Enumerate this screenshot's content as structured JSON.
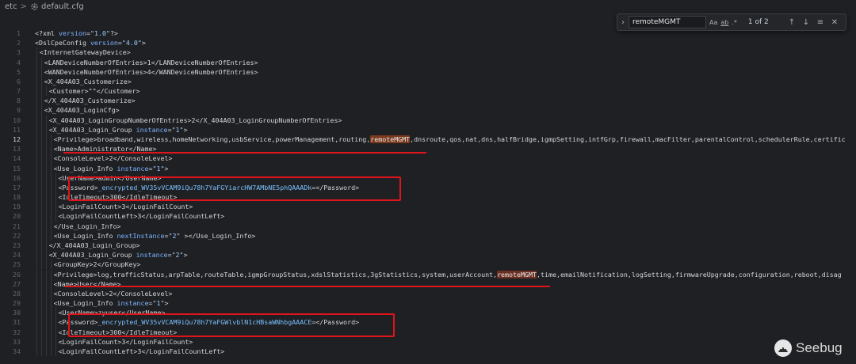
{
  "breadcrumb": {
    "folder": "etc",
    "separator": ">",
    "file": "default.cfg"
  },
  "find_widget": {
    "query": "remoteMGMT",
    "match_case_label": "Aa",
    "whole_word_label": "ab",
    "regex_label": ".*",
    "result": "1 of 2"
  },
  "watermark": {
    "text": "Seebug"
  },
  "current_line": 12,
  "lines": [
    {
      "n": 1,
      "indent": 0,
      "parts": [
        [
          "t",
          "<?xml "
        ],
        [
          "a",
          "version"
        ],
        [
          "t",
          "="
        ],
        [
          "v",
          "\"1.0\""
        ],
        [
          "t",
          "?>"
        ]
      ]
    },
    {
      "n": 2,
      "indent": 0,
      "parts": [
        [
          "t",
          "<DslCpeConfig "
        ],
        [
          "a",
          "version"
        ],
        [
          "t",
          "="
        ],
        [
          "v",
          "\"4.0\""
        ],
        [
          "t",
          ">"
        ]
      ]
    },
    {
      "n": 3,
      "indent": 1,
      "parts": [
        [
          "t",
          "<InternetGatewayDevice>"
        ]
      ]
    },
    {
      "n": 4,
      "indent": 2,
      "parts": [
        [
          "t",
          "<LANDeviceNumberOfEntries>1</LANDeviceNumberOfEntries>"
        ]
      ]
    },
    {
      "n": 5,
      "indent": 2,
      "parts": [
        [
          "t",
          "<WANDeviceNumberOfEntries>4</WANDeviceNumberOfEntries>"
        ]
      ]
    },
    {
      "n": 6,
      "indent": 2,
      "parts": [
        [
          "t",
          "<X_404A03_Customerize>"
        ]
      ]
    },
    {
      "n": 7,
      "indent": 3,
      "parts": [
        [
          "t",
          "<Customer>\"\"</Customer>"
        ]
      ]
    },
    {
      "n": 8,
      "indent": 2,
      "parts": [
        [
          "t",
          "</X_404A03_Customerize>"
        ]
      ]
    },
    {
      "n": 9,
      "indent": 2,
      "parts": [
        [
          "t",
          "<X_404A03_LoginCfg>"
        ]
      ]
    },
    {
      "n": 10,
      "indent": 3,
      "parts": [
        [
          "t",
          "<X_404A03_LoginGroupNumberOfEntries>2</X_404A03_LoginGroupNumberOfEntries>"
        ]
      ]
    },
    {
      "n": 11,
      "indent": 3,
      "parts": [
        [
          "t",
          "<X_404A03_Login_Group "
        ],
        [
          "a",
          "instance"
        ],
        [
          "t",
          "="
        ],
        [
          "v",
          "\"1\""
        ],
        [
          "t",
          ">"
        ]
      ]
    },
    {
      "n": 12,
      "indent": 4,
      "parts": [
        [
          "t",
          "<Privilege>broadband,wireless,homeNetworking,usbService,powerManagement,routing,"
        ],
        [
          "h",
          "remoteMGMT"
        ],
        [
          "t",
          ",dnsroute,qos,nat,dns,halfBridge,igmpSetting,intfGrp,firewall,macFilter,parentalControl,schedulerRule,certific"
        ]
      ]
    },
    {
      "n": 13,
      "indent": 4,
      "parts": [
        [
          "t",
          "<Name>Administrator</Name>"
        ]
      ]
    },
    {
      "n": 14,
      "indent": 4,
      "parts": [
        [
          "t",
          "<ConsoleLevel>2</ConsoleLevel>"
        ]
      ]
    },
    {
      "n": 15,
      "indent": 4,
      "parts": [
        [
          "t",
          "<Use_Login_Info "
        ],
        [
          "a",
          "instance"
        ],
        [
          "t",
          "="
        ],
        [
          "v",
          "\"1\""
        ],
        [
          "t",
          ">"
        ]
      ]
    },
    {
      "n": 16,
      "indent": 5,
      "parts": [
        [
          "t",
          "<UserName>admin</UserName>"
        ]
      ]
    },
    {
      "n": 17,
      "indent": 5,
      "parts": [
        [
          "t",
          "<Password>"
        ],
        [
          "e",
          "_encrypted_WV35vVCAM9iQu78h7YaFGYiarcHW7AMbNE5phQAAADk"
        ],
        [
          "t",
          "=</Password>"
        ]
      ]
    },
    {
      "n": 18,
      "indent": 5,
      "parts": [
        [
          "t",
          "<IdleTimeout>300</IdleTimeout>"
        ]
      ]
    },
    {
      "n": 19,
      "indent": 5,
      "parts": [
        [
          "t",
          "<LoginFailCount>3</LoginFailCount>"
        ]
      ]
    },
    {
      "n": 20,
      "indent": 5,
      "parts": [
        [
          "t",
          "<LoginFailCountLeft>3</LoginFailCountLeft>"
        ]
      ]
    },
    {
      "n": 21,
      "indent": 4,
      "parts": [
        [
          "t",
          "</Use_Login_Info>"
        ]
      ]
    },
    {
      "n": 22,
      "indent": 4,
      "parts": [
        [
          "t",
          "<Use_Login_Info "
        ],
        [
          "a",
          "nextInstance"
        ],
        [
          "t",
          "="
        ],
        [
          "v",
          "\"2\""
        ],
        [
          "t",
          " ></Use_Login_Info>"
        ]
      ]
    },
    {
      "n": 23,
      "indent": 3,
      "parts": [
        [
          "t",
          "</X_404A03_Login_Group>"
        ]
      ]
    },
    {
      "n": 24,
      "indent": 3,
      "parts": [
        [
          "t",
          "<X_404A03_Login_Group "
        ],
        [
          "a",
          "instance"
        ],
        [
          "t",
          "="
        ],
        [
          "v",
          "\"2\""
        ],
        [
          "t",
          ">"
        ]
      ]
    },
    {
      "n": 25,
      "indent": 4,
      "parts": [
        [
          "t",
          "<GroupKey>2</GroupKey>"
        ]
      ]
    },
    {
      "n": 26,
      "indent": 4,
      "parts": [
        [
          "t",
          "<Privilege>log,trafficStatus,arpTable,routeTable,igmpGroupStatus,xdslStatistics,3gStatistics,system,userAccount,"
        ],
        [
          "h",
          "remoteMGMT"
        ],
        [
          "t",
          ",time,emailNotification,logSetting,firmwareUpgrade,configuration,reboot,disag"
        ]
      ]
    },
    {
      "n": 27,
      "indent": 4,
      "parts": [
        [
          "t",
          "<Name>User</Name>"
        ]
      ]
    },
    {
      "n": 28,
      "indent": 4,
      "parts": [
        [
          "t",
          "<ConsoleLevel>2</ConsoleLevel>"
        ]
      ]
    },
    {
      "n": 29,
      "indent": 4,
      "parts": [
        [
          "t",
          "<Use_Login_Info "
        ],
        [
          "a",
          "instance"
        ],
        [
          "t",
          "="
        ],
        [
          "v",
          "\"1\""
        ],
        [
          "t",
          ">"
        ]
      ]
    },
    {
      "n": 30,
      "indent": 5,
      "parts": [
        [
          "t",
          "<UserName>zyuser</UserName>"
        ]
      ]
    },
    {
      "n": 31,
      "indent": 5,
      "parts": [
        [
          "t",
          "<Password>"
        ],
        [
          "e",
          "_encrypted_WV35vVCAM9iQu78h7YaFGWlvblN1cHBsaWNhbgAAACE"
        ],
        [
          "t",
          "=</Password>"
        ]
      ]
    },
    {
      "n": 32,
      "indent": 5,
      "parts": [
        [
          "t",
          "<IdleTimeout>300</IdleTimeout>"
        ]
      ]
    },
    {
      "n": 33,
      "indent": 5,
      "parts": [
        [
          "t",
          "<LoginFailCount>3</LoginFailCount>"
        ]
      ]
    },
    {
      "n": 34,
      "indent": 5,
      "parts": [
        [
          "t",
          "<LoginFailCountLeft>3</LoginFailCountLeft>"
        ]
      ]
    }
  ]
}
